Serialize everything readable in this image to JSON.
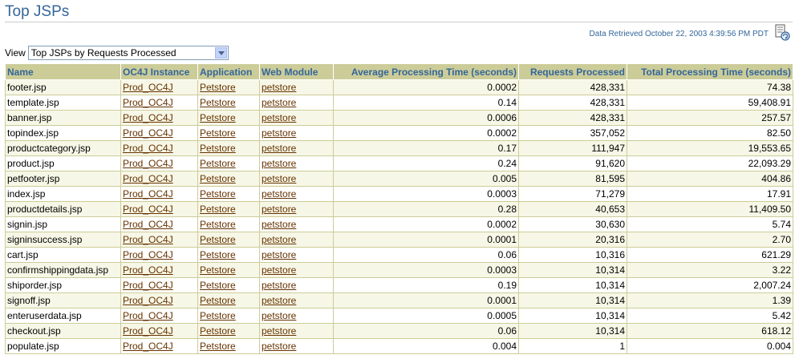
{
  "page": {
    "title": "Top JSPs",
    "data_retrieved": "Data Retrieved October 22, 2003 4:39:56 PM PDT"
  },
  "view": {
    "label": "View",
    "selected": "Top JSPs by Requests Processed"
  },
  "colors": {
    "header_bg": "#cccc99",
    "header_text": "#336699",
    "link": "#663300",
    "row_alt": "#f7f7e7"
  },
  "table": {
    "columns": [
      "Name",
      "OC4J Instance",
      "Application",
      "Web Module",
      "Average Processing Time (seconds)",
      "Requests Processed",
      "Total Processing Time (seconds)"
    ],
    "rows": [
      [
        "footer.jsp",
        "Prod_OC4J",
        "Petstore",
        "petstore",
        "0.0002",
        "428,331",
        "74.38"
      ],
      [
        "template.jsp",
        "Prod_OC4J",
        "Petstore",
        "petstore",
        "0.14",
        "428,331",
        "59,408.91"
      ],
      [
        "banner.jsp",
        "Prod_OC4J",
        "Petstore",
        "petstore",
        "0.0006",
        "428,331",
        "257.57"
      ],
      [
        "topindex.jsp",
        "Prod_OC4J",
        "Petstore",
        "petstore",
        "0.0002",
        "357,052",
        "82.50"
      ],
      [
        "productcategory.jsp",
        "Prod_OC4J",
        "Petstore",
        "petstore",
        "0.17",
        "111,947",
        "19,553.65"
      ],
      [
        "product.jsp",
        "Prod_OC4J",
        "Petstore",
        "petstore",
        "0.24",
        "91,620",
        "22,093.29"
      ],
      [
        "petfooter.jsp",
        "Prod_OC4J",
        "Petstore",
        "petstore",
        "0.005",
        "81,595",
        "404.86"
      ],
      [
        "index.jsp",
        "Prod_OC4J",
        "Petstore",
        "petstore",
        "0.0003",
        "71,279",
        "17.91"
      ],
      [
        "productdetails.jsp",
        "Prod_OC4J",
        "Petstore",
        "petstore",
        "0.28",
        "40,653",
        "11,409.50"
      ],
      [
        "signin.jsp",
        "Prod_OC4J",
        "Petstore",
        "petstore",
        "0.0002",
        "30,630",
        "5.74"
      ],
      [
        "signinsuccess.jsp",
        "Prod_OC4J",
        "Petstore",
        "petstore",
        "0.0001",
        "20,316",
        "2.70"
      ],
      [
        "cart.jsp",
        "Prod_OC4J",
        "Petstore",
        "petstore",
        "0.06",
        "10,316",
        "621.29"
      ],
      [
        "confirmshippingdata.jsp",
        "Prod_OC4J",
        "Petstore",
        "petstore",
        "0.0003",
        "10,314",
        "3.22"
      ],
      [
        "shiporder.jsp",
        "Prod_OC4J",
        "Petstore",
        "petstore",
        "0.19",
        "10,314",
        "2,007.24"
      ],
      [
        "signoff.jsp",
        "Prod_OC4J",
        "Petstore",
        "petstore",
        "0.0001",
        "10,314",
        "1.39"
      ],
      [
        "enteruserdata.jsp",
        "Prod_OC4J",
        "Petstore",
        "petstore",
        "0.0005",
        "10,314",
        "5.42"
      ],
      [
        "checkout.jsp",
        "Prod_OC4J",
        "Petstore",
        "petstore",
        "0.06",
        "10,314",
        "618.12"
      ],
      [
        "populate.jsp",
        "Prod_OC4J",
        "Petstore",
        "petstore",
        "0.004",
        "1",
        "0.004"
      ]
    ]
  },
  "icons": {
    "export": "export-document-icon",
    "dropdown": "chevron-down-icon"
  }
}
